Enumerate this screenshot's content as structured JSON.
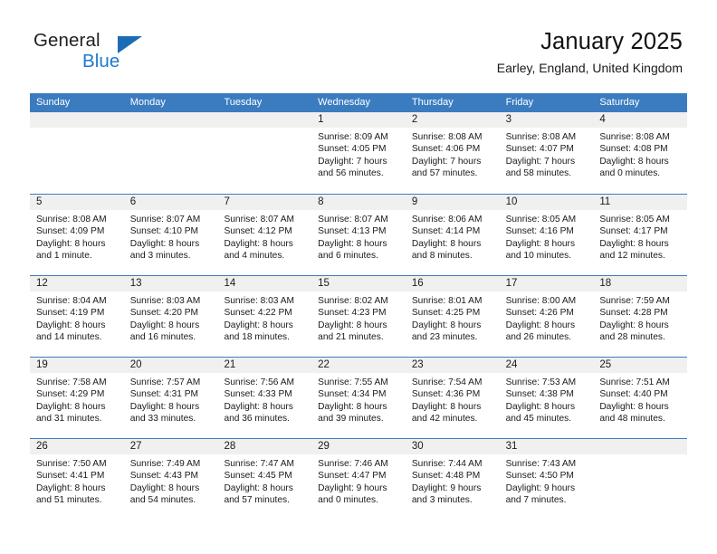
{
  "brand": {
    "name_top": "General",
    "name_bottom": "Blue",
    "accent_color": "#1b7ad1",
    "triangle_color": "#1b6cb5"
  },
  "header": {
    "title": "January 2025",
    "subtitle": "Earley, England, United Kingdom"
  },
  "calendar": {
    "header_bg": "#3b7cc0",
    "day_band_bg": "#f0f0f0",
    "weekdays": [
      "Sunday",
      "Monday",
      "Tuesday",
      "Wednesday",
      "Thursday",
      "Friday",
      "Saturday"
    ],
    "weeks": [
      [
        {
          "day": "",
          "empty": true
        },
        {
          "day": "",
          "empty": true
        },
        {
          "day": "",
          "empty": true
        },
        {
          "day": "1",
          "sunrise": "Sunrise: 8:09 AM",
          "sunset": "Sunset: 4:05 PM",
          "daylight1": "Daylight: 7 hours",
          "daylight2": "and 56 minutes."
        },
        {
          "day": "2",
          "sunrise": "Sunrise: 8:08 AM",
          "sunset": "Sunset: 4:06 PM",
          "daylight1": "Daylight: 7 hours",
          "daylight2": "and 57 minutes."
        },
        {
          "day": "3",
          "sunrise": "Sunrise: 8:08 AM",
          "sunset": "Sunset: 4:07 PM",
          "daylight1": "Daylight: 7 hours",
          "daylight2": "and 58 minutes."
        },
        {
          "day": "4",
          "sunrise": "Sunrise: 8:08 AM",
          "sunset": "Sunset: 4:08 PM",
          "daylight1": "Daylight: 8 hours",
          "daylight2": "and 0 minutes."
        }
      ],
      [
        {
          "day": "5",
          "sunrise": "Sunrise: 8:08 AM",
          "sunset": "Sunset: 4:09 PM",
          "daylight1": "Daylight: 8 hours",
          "daylight2": "and 1 minute."
        },
        {
          "day": "6",
          "sunrise": "Sunrise: 8:07 AM",
          "sunset": "Sunset: 4:10 PM",
          "daylight1": "Daylight: 8 hours",
          "daylight2": "and 3 minutes."
        },
        {
          "day": "7",
          "sunrise": "Sunrise: 8:07 AM",
          "sunset": "Sunset: 4:12 PM",
          "daylight1": "Daylight: 8 hours",
          "daylight2": "and 4 minutes."
        },
        {
          "day": "8",
          "sunrise": "Sunrise: 8:07 AM",
          "sunset": "Sunset: 4:13 PM",
          "daylight1": "Daylight: 8 hours",
          "daylight2": "and 6 minutes."
        },
        {
          "day": "9",
          "sunrise": "Sunrise: 8:06 AM",
          "sunset": "Sunset: 4:14 PM",
          "daylight1": "Daylight: 8 hours",
          "daylight2": "and 8 minutes."
        },
        {
          "day": "10",
          "sunrise": "Sunrise: 8:05 AM",
          "sunset": "Sunset: 4:16 PM",
          "daylight1": "Daylight: 8 hours",
          "daylight2": "and 10 minutes."
        },
        {
          "day": "11",
          "sunrise": "Sunrise: 8:05 AM",
          "sunset": "Sunset: 4:17 PM",
          "daylight1": "Daylight: 8 hours",
          "daylight2": "and 12 minutes."
        }
      ],
      [
        {
          "day": "12",
          "sunrise": "Sunrise: 8:04 AM",
          "sunset": "Sunset: 4:19 PM",
          "daylight1": "Daylight: 8 hours",
          "daylight2": "and 14 minutes."
        },
        {
          "day": "13",
          "sunrise": "Sunrise: 8:03 AM",
          "sunset": "Sunset: 4:20 PM",
          "daylight1": "Daylight: 8 hours",
          "daylight2": "and 16 minutes."
        },
        {
          "day": "14",
          "sunrise": "Sunrise: 8:03 AM",
          "sunset": "Sunset: 4:22 PM",
          "daylight1": "Daylight: 8 hours",
          "daylight2": "and 18 minutes."
        },
        {
          "day": "15",
          "sunrise": "Sunrise: 8:02 AM",
          "sunset": "Sunset: 4:23 PM",
          "daylight1": "Daylight: 8 hours",
          "daylight2": "and 21 minutes."
        },
        {
          "day": "16",
          "sunrise": "Sunrise: 8:01 AM",
          "sunset": "Sunset: 4:25 PM",
          "daylight1": "Daylight: 8 hours",
          "daylight2": "and 23 minutes."
        },
        {
          "day": "17",
          "sunrise": "Sunrise: 8:00 AM",
          "sunset": "Sunset: 4:26 PM",
          "daylight1": "Daylight: 8 hours",
          "daylight2": "and 26 minutes."
        },
        {
          "day": "18",
          "sunrise": "Sunrise: 7:59 AM",
          "sunset": "Sunset: 4:28 PM",
          "daylight1": "Daylight: 8 hours",
          "daylight2": "and 28 minutes."
        }
      ],
      [
        {
          "day": "19",
          "sunrise": "Sunrise: 7:58 AM",
          "sunset": "Sunset: 4:29 PM",
          "daylight1": "Daylight: 8 hours",
          "daylight2": "and 31 minutes."
        },
        {
          "day": "20",
          "sunrise": "Sunrise: 7:57 AM",
          "sunset": "Sunset: 4:31 PM",
          "daylight1": "Daylight: 8 hours",
          "daylight2": "and 33 minutes."
        },
        {
          "day": "21",
          "sunrise": "Sunrise: 7:56 AM",
          "sunset": "Sunset: 4:33 PM",
          "daylight1": "Daylight: 8 hours",
          "daylight2": "and 36 minutes."
        },
        {
          "day": "22",
          "sunrise": "Sunrise: 7:55 AM",
          "sunset": "Sunset: 4:34 PM",
          "daylight1": "Daylight: 8 hours",
          "daylight2": "and 39 minutes."
        },
        {
          "day": "23",
          "sunrise": "Sunrise: 7:54 AM",
          "sunset": "Sunset: 4:36 PM",
          "daylight1": "Daylight: 8 hours",
          "daylight2": "and 42 minutes."
        },
        {
          "day": "24",
          "sunrise": "Sunrise: 7:53 AM",
          "sunset": "Sunset: 4:38 PM",
          "daylight1": "Daylight: 8 hours",
          "daylight2": "and 45 minutes."
        },
        {
          "day": "25",
          "sunrise": "Sunrise: 7:51 AM",
          "sunset": "Sunset: 4:40 PM",
          "daylight1": "Daylight: 8 hours",
          "daylight2": "and 48 minutes."
        }
      ],
      [
        {
          "day": "26",
          "sunrise": "Sunrise: 7:50 AM",
          "sunset": "Sunset: 4:41 PM",
          "daylight1": "Daylight: 8 hours",
          "daylight2": "and 51 minutes."
        },
        {
          "day": "27",
          "sunrise": "Sunrise: 7:49 AM",
          "sunset": "Sunset: 4:43 PM",
          "daylight1": "Daylight: 8 hours",
          "daylight2": "and 54 minutes."
        },
        {
          "day": "28",
          "sunrise": "Sunrise: 7:47 AM",
          "sunset": "Sunset: 4:45 PM",
          "daylight1": "Daylight: 8 hours",
          "daylight2": "and 57 minutes."
        },
        {
          "day": "29",
          "sunrise": "Sunrise: 7:46 AM",
          "sunset": "Sunset: 4:47 PM",
          "daylight1": "Daylight: 9 hours",
          "daylight2": "and 0 minutes."
        },
        {
          "day": "30",
          "sunrise": "Sunrise: 7:44 AM",
          "sunset": "Sunset: 4:48 PM",
          "daylight1": "Daylight: 9 hours",
          "daylight2": "and 3 minutes."
        },
        {
          "day": "31",
          "sunrise": "Sunrise: 7:43 AM",
          "sunset": "Sunset: 4:50 PM",
          "daylight1": "Daylight: 9 hours",
          "daylight2": "and 7 minutes."
        },
        {
          "day": "",
          "empty": true
        }
      ]
    ]
  }
}
